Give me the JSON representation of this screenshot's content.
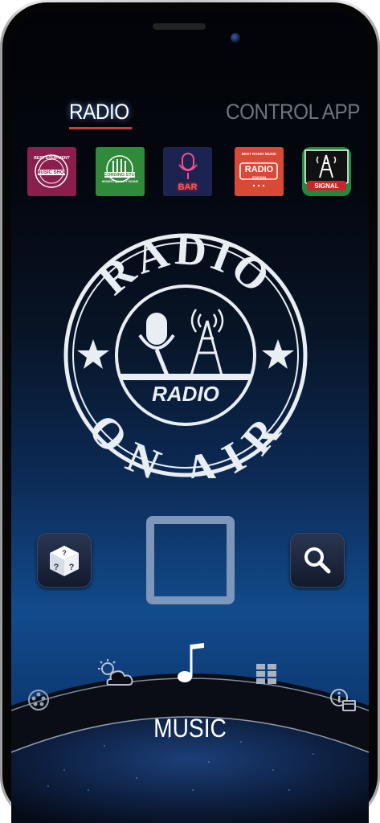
{
  "tabs": {
    "radio": "RADIO",
    "control_app": "CONTROL APP",
    "active": "radio",
    "active_underline_color": "#d63b3b"
  },
  "stations": [
    {
      "icon": "music-shop-badge-icon",
      "lines": [
        "BEST EQUIPMENT",
        "MUSIC SHOP"
      ],
      "color": "#8a1f4e"
    },
    {
      "icon": "recording-studio-badge-icon",
      "lines": [
        "RECORDING STUDIO",
        "HIGHEST QUALITY SOUND"
      ],
      "color": "#2f8a3a"
    },
    {
      "icon": "bar-microphone-neon-icon",
      "lines": [
        "BAR"
      ],
      "color": "#1b2350"
    },
    {
      "icon": "radio-station-badge-icon",
      "lines": [
        "BEST RADIO MUSIC",
        "RADIO",
        "STATION"
      ],
      "color": "#d94a36"
    },
    {
      "icon": "signal-tower-badge-icon",
      "lines": [
        "SIGNAL"
      ],
      "color": "#1e8a3c"
    }
  ],
  "logo": {
    "top_text": "RADIO",
    "center_text": "RADIO",
    "bottom_text": "ON AIR"
  },
  "controls": {
    "random_icon": "dice-question-icon",
    "play_state": "stopped",
    "search_icon": "search-icon"
  },
  "dock": {
    "items": [
      {
        "icon": "film-reel-icon"
      },
      {
        "icon": "weather-sun-cloud-icon"
      },
      {
        "icon": "music-note-icon",
        "active": true
      },
      {
        "icon": "grid-icon"
      },
      {
        "icon": "info-card-icon"
      }
    ],
    "active_label": "MUSIC"
  }
}
